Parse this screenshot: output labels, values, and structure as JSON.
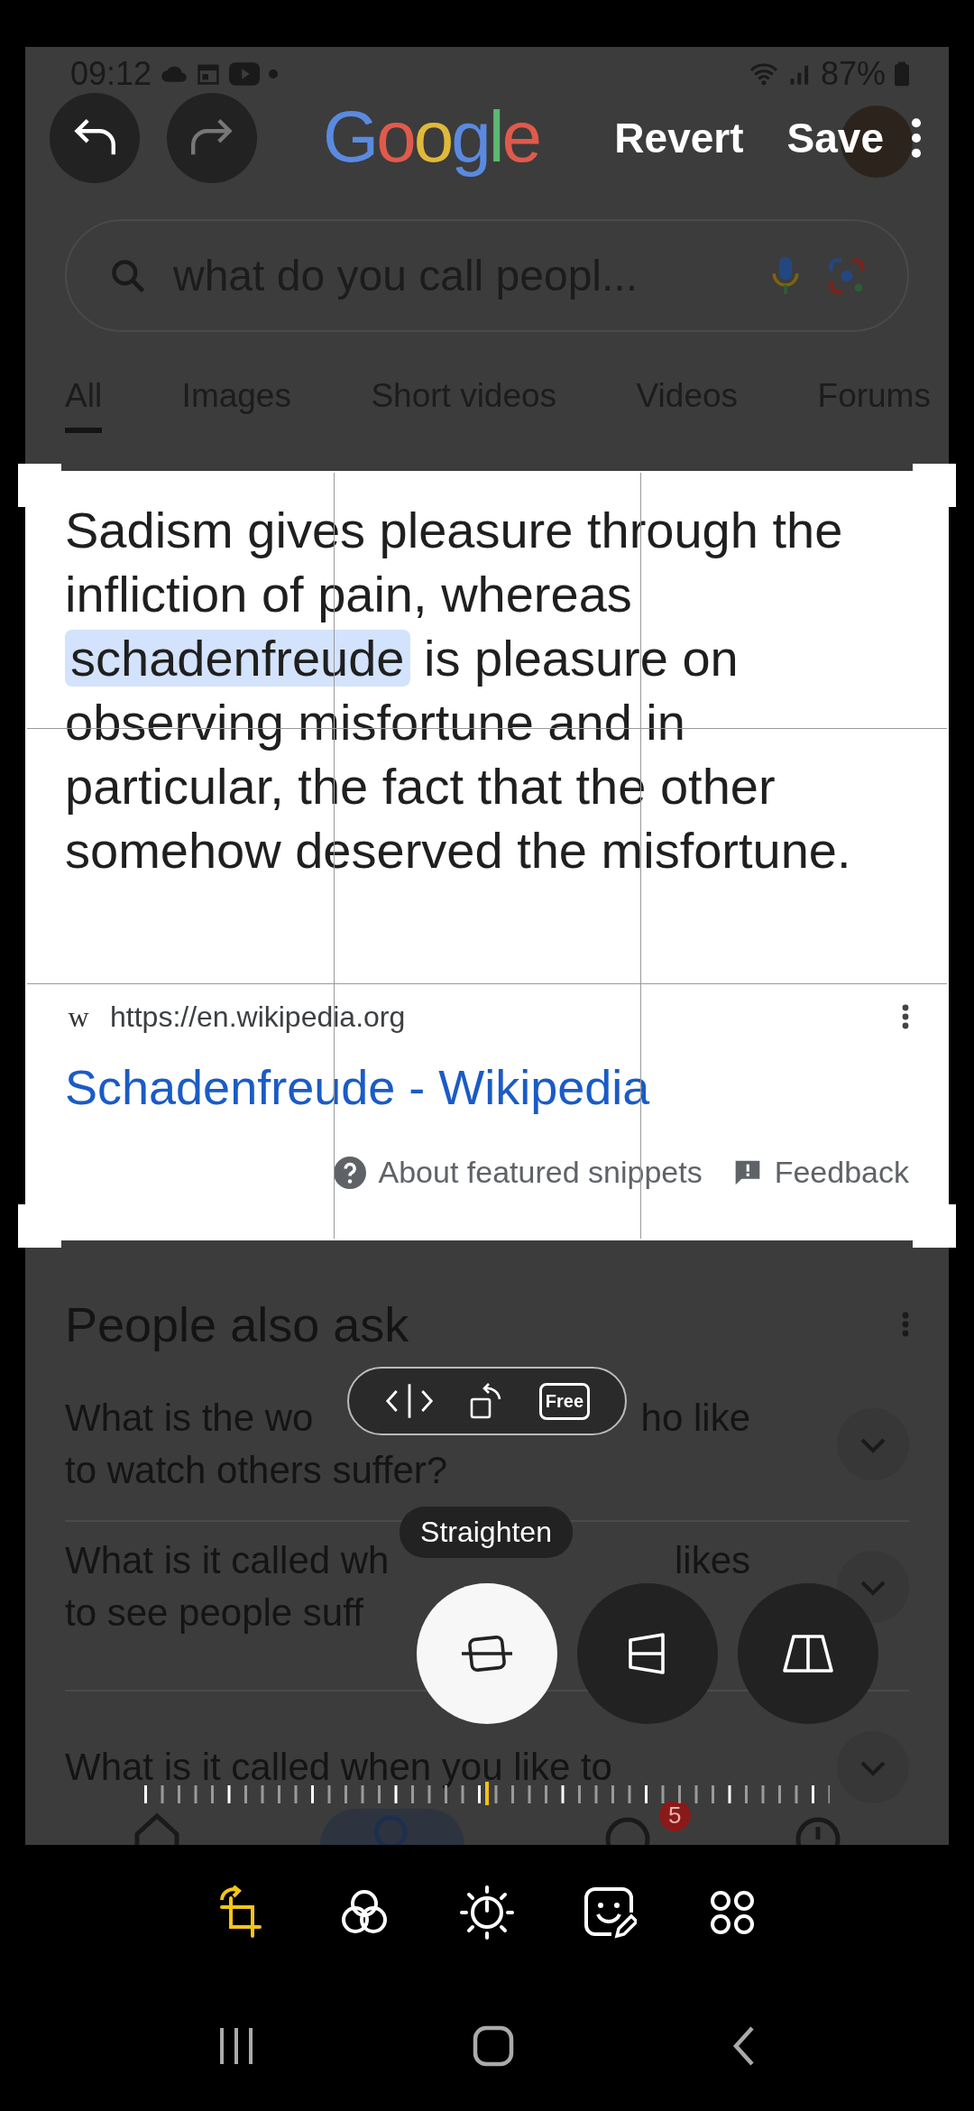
{
  "status_bar": {
    "time": "09:12",
    "battery": "87%"
  },
  "editor_bar": {
    "actions": [
      "Revert",
      "Save"
    ]
  },
  "page": {
    "logo": "Google",
    "search": {
      "value": "what do you call peopl..."
    },
    "tabs": [
      {
        "label": "All",
        "selected": true
      },
      {
        "label": "Images",
        "selected": false
      },
      {
        "label": "Short videos",
        "selected": false
      },
      {
        "label": "Videos",
        "selected": false
      },
      {
        "label": "Forums",
        "selected": false
      }
    ],
    "snippet": {
      "text_before": "Sadism gives pleasure through the infliction of pain, whereas",
      "highlight": "schadenfreude",
      "text_after": "is pleasure on observing misfortune and in particular, the fact that the other somehow deserved the misfortune.",
      "site_letter": "w",
      "url": "https://en.wikipedia.org",
      "title": "Schadenfreude - Wikipedia",
      "links": [
        "About featured snippets",
        "Feedback"
      ]
    },
    "people_also_ask": {
      "title": "People also ask",
      "questions": [
        {
          "lines": [
            [
              "What is the wo",
              "ho like"
            ],
            [
              "to watch others suffer?"
            ]
          ]
        },
        {
          "lines": [
            [
              "What is it called wh",
              "likes"
            ],
            [
              "to see people suff"
            ]
          ]
        },
        {
          "lines": [
            [
              "What is it called when you like to"
            ]
          ]
        }
      ]
    },
    "nav_badge": "5"
  },
  "crop_toolbar": {
    "free_label": "Free"
  },
  "tooltip": "Straighten",
  "crop_modes": [
    {
      "kind": "straighten",
      "selected": true
    },
    {
      "kind": "vertical",
      "selected": false
    },
    {
      "kind": "horizontal",
      "selected": false
    }
  ],
  "ruler": {
    "level": 0.5
  },
  "tools": [
    {
      "kind": "crop",
      "selected": true
    },
    {
      "kind": "filters",
      "selected": false
    },
    {
      "kind": "adjust",
      "selected": false
    },
    {
      "kind": "decorate",
      "selected": false
    },
    {
      "kind": "more",
      "selected": false
    }
  ]
}
